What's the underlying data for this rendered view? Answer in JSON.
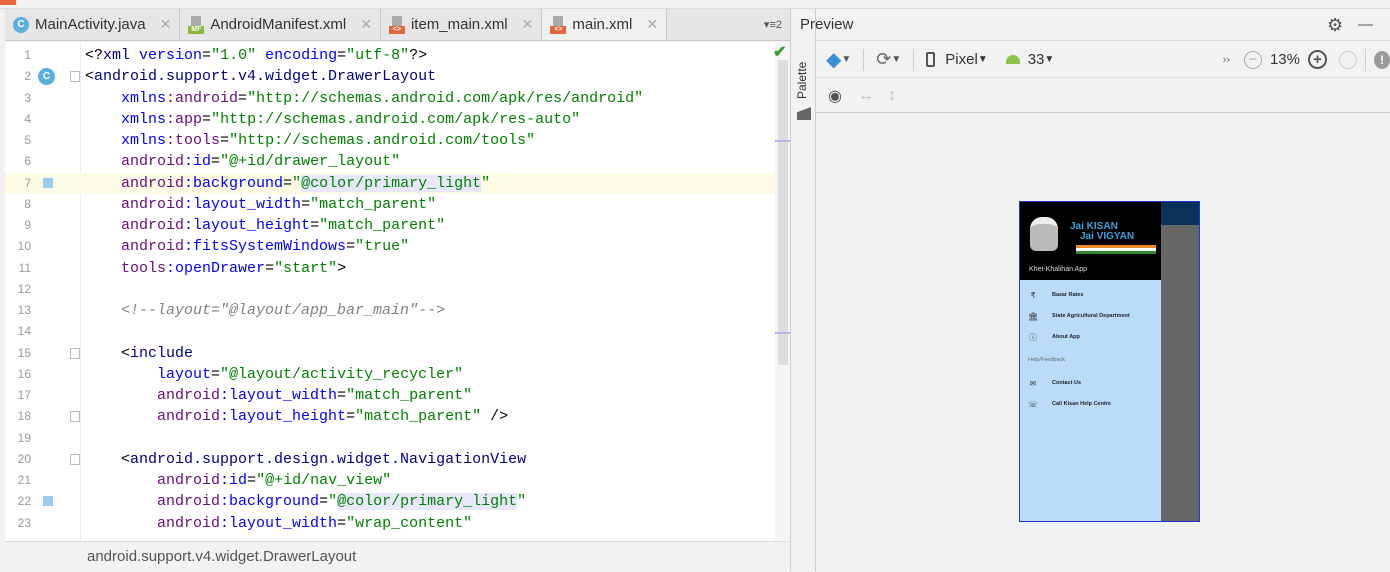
{
  "tabs": [
    {
      "label": "MainActivity.java",
      "icon": "java-class-icon",
      "badge": "C"
    },
    {
      "label": "AndroidManifest.xml",
      "icon": "manifest-file-icon",
      "badge": "MF"
    },
    {
      "label": "item_main.xml",
      "icon": "xml-layout-file-icon",
      "badge": "<>"
    },
    {
      "label": "main.xml",
      "icon": "xml-layout-file-icon",
      "badge": "<>"
    }
  ],
  "tab_overflow_count": "2",
  "editor": {
    "current_line": 7,
    "lines": [
      [
        [
          "p",
          "<?"
        ],
        [
          "tag",
          "xml "
        ],
        [
          "attr",
          "version"
        ],
        [
          "p",
          "="
        ],
        [
          "val",
          "\"1.0\" "
        ],
        [
          "attr",
          "encoding"
        ],
        [
          "p",
          "="
        ],
        [
          "val",
          "\"utf-8\""
        ],
        [
          "p",
          "?>"
        ]
      ],
      [
        [
          "p",
          "<"
        ],
        [
          "tag",
          "android.support.v4.widget.DrawerLayout"
        ]
      ],
      [
        [
          "p",
          "    "
        ],
        [
          "attr",
          "xmlns"
        ],
        [
          "ns",
          ":android"
        ],
        [
          "p",
          "="
        ],
        [
          "val",
          "\"http://schemas.android.com/apk/res/android\""
        ]
      ],
      [
        [
          "p",
          "    "
        ],
        [
          "attr",
          "xmlns"
        ],
        [
          "ns",
          ":app"
        ],
        [
          "p",
          "="
        ],
        [
          "val",
          "\"http://schemas.android.com/apk/res-auto\""
        ]
      ],
      [
        [
          "p",
          "    "
        ],
        [
          "attr",
          "xmlns"
        ],
        [
          "ns",
          ":tools"
        ],
        [
          "p",
          "="
        ],
        [
          "val",
          "\"http://schemas.android.com/tools\""
        ]
      ],
      [
        [
          "p",
          "    "
        ],
        [
          "ns",
          "android"
        ],
        [
          "attr",
          ":id"
        ],
        [
          "p",
          "="
        ],
        [
          "val",
          "\"@+id/drawer_layout\""
        ]
      ],
      [
        [
          "p",
          "    "
        ],
        [
          "ns",
          "android"
        ],
        [
          "attr",
          ":background"
        ],
        [
          "p",
          "="
        ],
        [
          "val",
          "\""
        ],
        [
          "ref",
          "@color/primary_light"
        ],
        [
          "val",
          "\""
        ]
      ],
      [
        [
          "p",
          "    "
        ],
        [
          "ns",
          "android"
        ],
        [
          "attr",
          ":layout_width"
        ],
        [
          "p",
          "="
        ],
        [
          "val",
          "\"match_parent\""
        ]
      ],
      [
        [
          "p",
          "    "
        ],
        [
          "ns",
          "android"
        ],
        [
          "attr",
          ":layout_height"
        ],
        [
          "p",
          "="
        ],
        [
          "val",
          "\"match_parent\""
        ]
      ],
      [
        [
          "p",
          "    "
        ],
        [
          "ns",
          "android"
        ],
        [
          "attr",
          ":fitsSystemWindows"
        ],
        [
          "p",
          "="
        ],
        [
          "val",
          "\"true\""
        ]
      ],
      [
        [
          "p",
          "    "
        ],
        [
          "ns",
          "tools"
        ],
        [
          "attr",
          ":openDrawer"
        ],
        [
          "p",
          "="
        ],
        [
          "val",
          "\"start\""
        ],
        [
          "p",
          ">"
        ]
      ],
      [],
      [
        [
          "p",
          "    "
        ],
        [
          "cm",
          "<!--layout=\"@layout/app_bar_main\"-->"
        ]
      ],
      [],
      [
        [
          "p",
          "    <"
        ],
        [
          "tag",
          "include"
        ]
      ],
      [
        [
          "p",
          "        "
        ],
        [
          "attr",
          "layout"
        ],
        [
          "p",
          "="
        ],
        [
          "val",
          "\"@layout/activity_recycler\""
        ]
      ],
      [
        [
          "p",
          "        "
        ],
        [
          "ns",
          "android"
        ],
        [
          "attr",
          ":layout_width"
        ],
        [
          "p",
          "="
        ],
        [
          "val",
          "\"match_parent\""
        ]
      ],
      [
        [
          "p",
          "        "
        ],
        [
          "ns",
          "android"
        ],
        [
          "attr",
          ":layout_height"
        ],
        [
          "p",
          "="
        ],
        [
          "val",
          "\"match_parent\" "
        ],
        [
          "p",
          "/>"
        ]
      ],
      [],
      [
        [
          "p",
          "    <"
        ],
        [
          "tag",
          "android.support.design.widget.NavigationView"
        ]
      ],
      [
        [
          "p",
          "        "
        ],
        [
          "ns",
          "android"
        ],
        [
          "attr",
          ":id"
        ],
        [
          "p",
          "="
        ],
        [
          "val",
          "\"@+id/nav_view\""
        ]
      ],
      [
        [
          "p",
          "        "
        ],
        [
          "ns",
          "android"
        ],
        [
          "attr",
          ":background"
        ],
        [
          "p",
          "="
        ],
        [
          "val",
          "\""
        ],
        [
          "ref",
          "@color/primary_light"
        ],
        [
          "val",
          "\""
        ]
      ],
      [
        [
          "p",
          "        "
        ],
        [
          "ns",
          "android"
        ],
        [
          "attr",
          ":layout_width"
        ],
        [
          "p",
          "="
        ],
        [
          "val",
          "\"wrap_content\""
        ]
      ]
    ],
    "gutter_class_badge": "C"
  },
  "breadcrumb": "android.support.v4.widget.DrawerLayout",
  "side_tab": "Palette",
  "preview": {
    "title": "Preview",
    "device": "Pixel",
    "api_level": "33",
    "zoom": "13%",
    "app": {
      "header_title": "Khet-Khalihan App",
      "logo_text": [
        "Jai KISAN",
        "Jai VIGYAN"
      ],
      "items": [
        {
          "icon": "₹",
          "label": "Bazar Rates"
        },
        {
          "icon": "🏛",
          "label": "State Agricultural Department"
        },
        {
          "icon": "ⓘ",
          "label": "About App"
        }
      ],
      "section": "Help/Feedback",
      "items2": [
        {
          "icon": "✉",
          "label": "Contact Us"
        },
        {
          "icon": "☏",
          "label": "Call Kisan Help Centre"
        }
      ]
    }
  },
  "colors": {
    "accent": "#3d8fd6",
    "drawer_bg": "#bbdcf8",
    "appbar": "#0a3158"
  }
}
